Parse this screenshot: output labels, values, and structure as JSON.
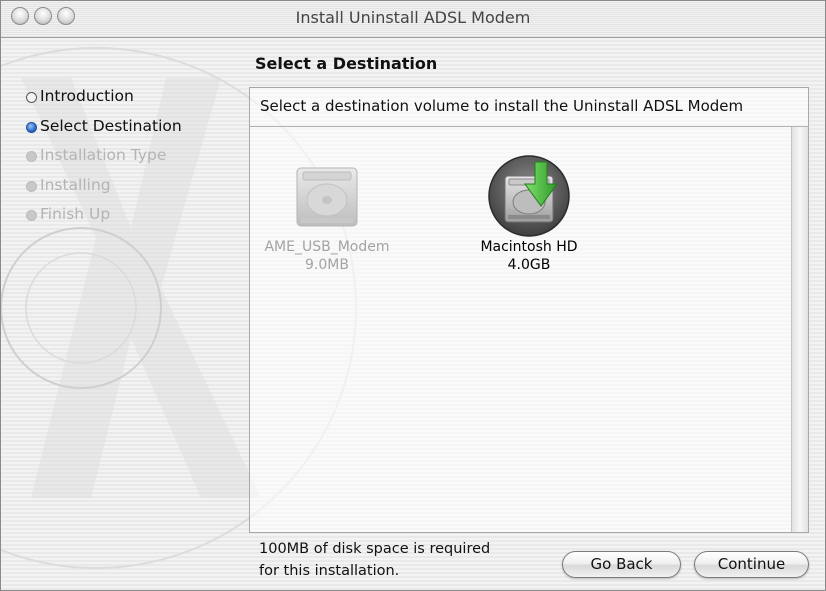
{
  "window": {
    "title": "Install Uninstall ADSL Modem"
  },
  "page_title": "Select a Destination",
  "steps": [
    {
      "label": "Introduction",
      "state": "done"
    },
    {
      "label": "Select Destination",
      "state": "current"
    },
    {
      "label": "Installation Type",
      "state": "future"
    },
    {
      "label": "Installing",
      "state": "future"
    },
    {
      "label": "Finish Up",
      "state": "future"
    }
  ],
  "panel": {
    "header": "Select a destination volume to install the Uninstall ADSL Modem"
  },
  "volumes": [
    {
      "name": "AME_USB_Modem",
      "size": "9.0MB",
      "enabled": false,
      "selected": false
    },
    {
      "name": "Macintosh HD",
      "size": "4.0GB",
      "enabled": true,
      "selected": true
    }
  ],
  "footer": {
    "line1": "100MB of disk space is required",
    "line2": "for this installation."
  },
  "buttons": {
    "back": "Go Back",
    "continue": "Continue"
  },
  "colors": {
    "current_step": "#2e6cc8",
    "install_arrow": "#3fb63a"
  }
}
